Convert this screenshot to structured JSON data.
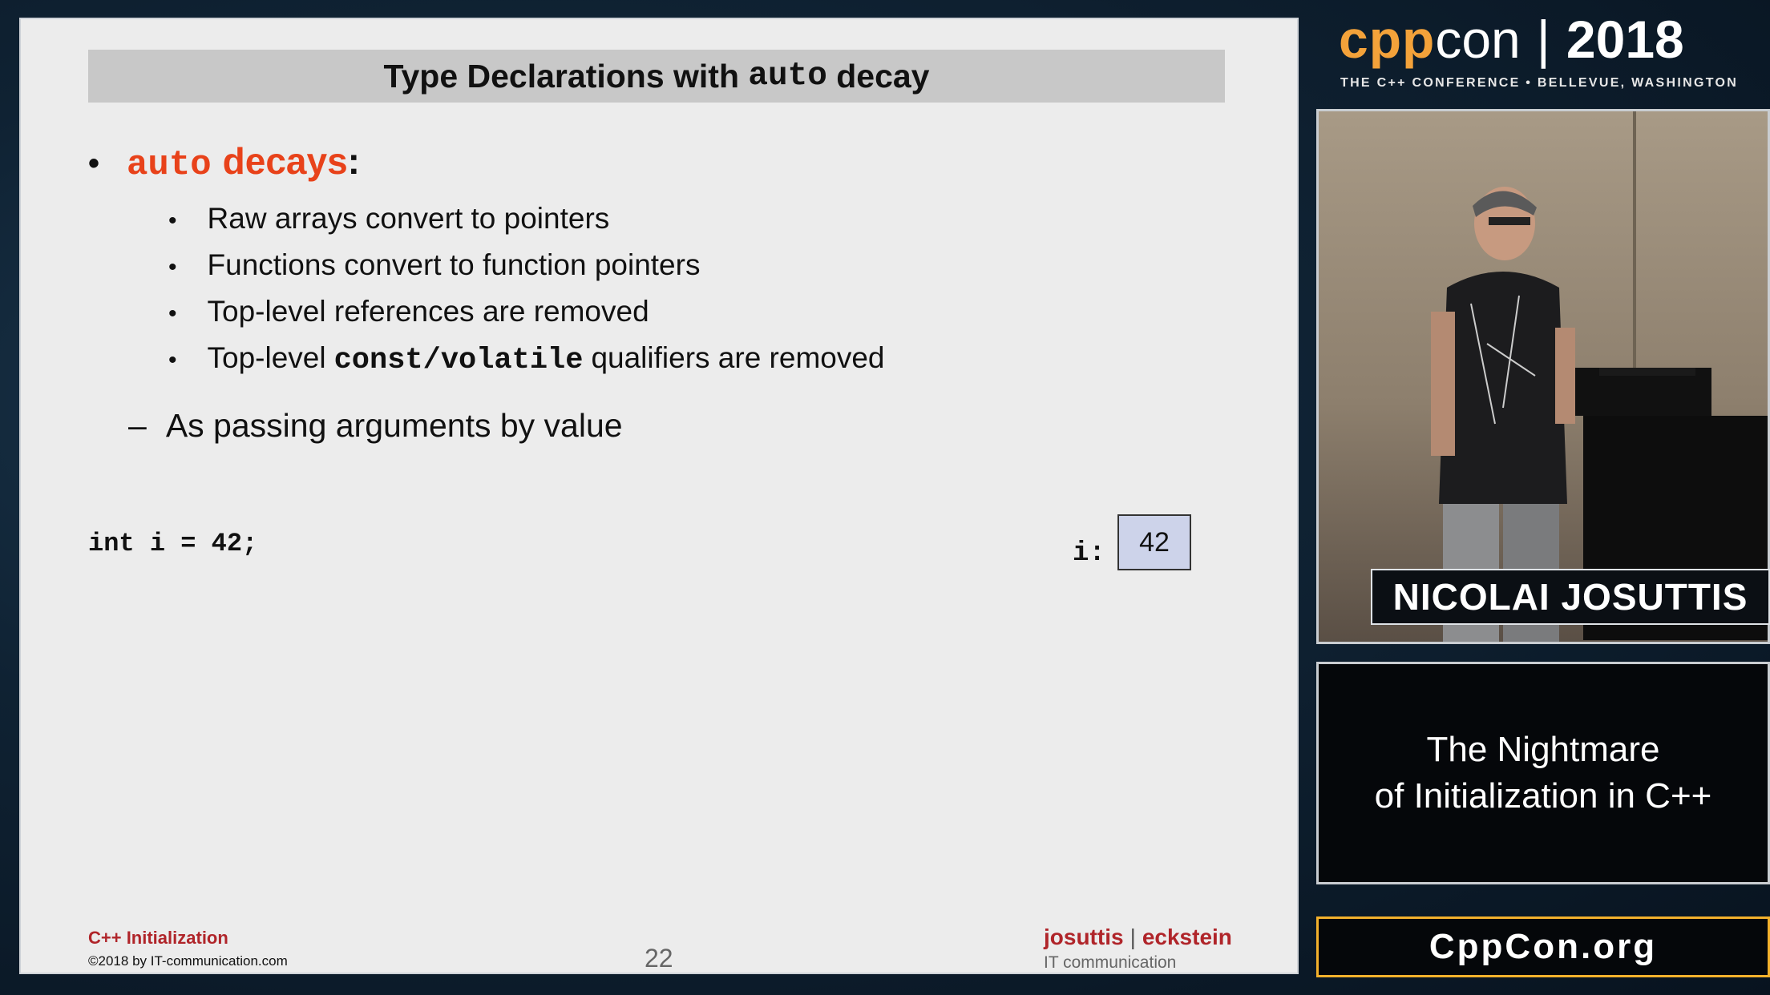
{
  "slide": {
    "title_pre": "Type Declarations with",
    "title_code": "auto",
    "title_post": "decay",
    "bullet_main_code": "auto",
    "bullet_main_word": "decays",
    "bullet_main_colon": ":",
    "sub_bullets": [
      "Raw arrays convert to pointers",
      "Functions convert to function pointers",
      "Top-level references are removed"
    ],
    "sub_bullet_4_pre": "Top-level",
    "sub_bullet_4_code": "const/volatile",
    "sub_bullet_4_post": "qualifiers are removed",
    "dash_item": "As passing arguments by value",
    "code_line": "int i = 42;",
    "var_label": "i:",
    "var_value": "42",
    "footer_course": "C++ Initialization",
    "footer_copyright": "©2018 by IT-communication.com",
    "page_number": "22",
    "brand_left": "josuttis",
    "brand_sep": "|",
    "brand_right": "eckstein",
    "brand_sub": "IT communication"
  },
  "overlay": {
    "logo_cpp": "cpp",
    "logo_con": "con",
    "logo_sep": "|",
    "logo_year": "2018",
    "tagline": "THE C++ CONFERENCE • BELLEVUE, WASHINGTON",
    "speaker_name": "NICOLAI JOSUTTIS",
    "talk_line1": "The Nightmare",
    "talk_line2": "of Initialization in C++",
    "site": "CppCon.org"
  },
  "colors": {
    "accent_orange": "#e8421a",
    "brand_red": "#b0252a",
    "logo_orange": "#f3a23a",
    "site_border": "#f3b12c"
  }
}
